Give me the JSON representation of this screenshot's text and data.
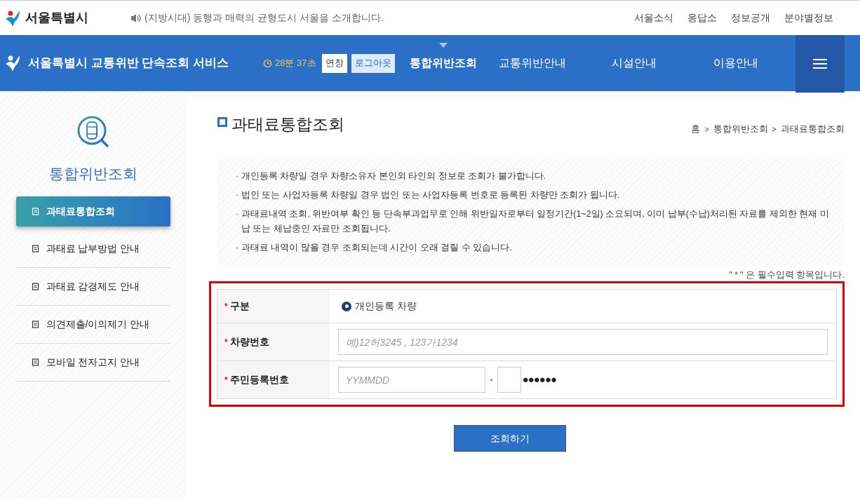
{
  "top_bar": {
    "logo": "서울특별시",
    "notice": "(지방시대) 동행과 매력의 균형도시 서울을 소개합니다.",
    "links": [
      "서울소식",
      "응답소",
      "정보공개",
      "분야별정보"
    ]
  },
  "header": {
    "title": "서울특별시 교통위반 단속조회 서비스",
    "timer": "28분 37초",
    "extend_button": "연장",
    "logout_button": "로그아웃",
    "nav": [
      {
        "label": "통합위반조회",
        "selected": true
      },
      {
        "label": "교통위반안내",
        "selected": false
      },
      {
        "label": "시설안내",
        "selected": false
      },
      {
        "label": "이용안내",
        "selected": false
      }
    ]
  },
  "sidebar": {
    "title": "통합위반조회",
    "items": [
      {
        "label": "과태료통합조회",
        "selected": true
      },
      {
        "label": "과태료 납부방법 안내",
        "selected": false
      },
      {
        "label": "과태료 감경제도 안내",
        "selected": false
      },
      {
        "label": "의견제출/이의제기 안내",
        "selected": false
      },
      {
        "label": "모바일 전자고지 안내",
        "selected": false
      }
    ]
  },
  "page": {
    "title": "과태료통합조회",
    "breadcrumb": [
      "홈",
      "통합위반조회",
      "과태료통합조회"
    ],
    "breadcrumb_separator": ">",
    "bullet": "·",
    "notices": [
      "개인등록 차량일 경우 차량소유자 본인외 타인의 정보로 조회가 불가합니다.",
      "법인 또는 사업자등록 차량일 경우 법인 또는 사업자등록 번호로 등록된 차량만 조회가 됩니다.",
      "과태료내역 조회, 위반여부 확인 등 단속부과업무로 인해 위반일자로부터 일정기간(1~2일) 소요되며, 이미 납부(수납)처리된 자료를 제외한 현재 미납 또는 체납중인 자료만 조회됩니다.",
      "과태료 내역이 많을 경우 조회되는데 시간이 오래 걸릴 수 있습니다."
    ],
    "required_note": {
      "open": "\"",
      "mark": "*",
      "rest": "\" 은 필수입력 항목입니다."
    },
    "form": [
      {
        "kind": "radio",
        "label": "구분",
        "required_mark": "*",
        "option": "개인등록 차량",
        "selected": true
      },
      {
        "kind": "text",
        "label": "차량번호",
        "required_mark": "*",
        "placeholder": "예)12허3245 , 123가1234"
      },
      {
        "kind": "resident",
        "label": "주민등록번호",
        "required_mark": "*",
        "placeholder": "YYMMDD",
        "separator": "-",
        "masked": "●●●●●●"
      }
    ],
    "submit_button": "조회하기"
  }
}
